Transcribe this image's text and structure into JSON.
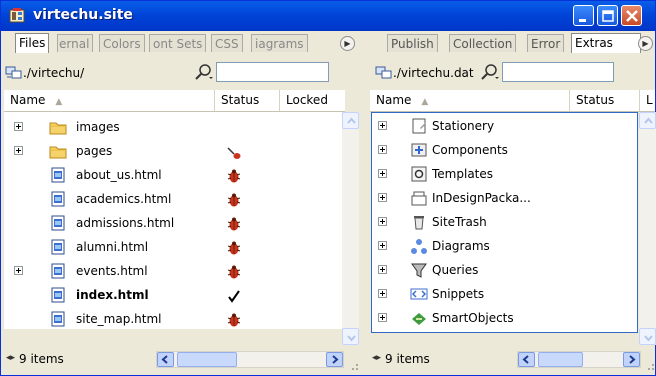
{
  "window": {
    "title": "virtechu.site",
    "controls": {
      "minimize": "minimize",
      "maximize": "maximize",
      "close": "close"
    }
  },
  "left_pane": {
    "tabs": [
      {
        "label": "Files",
        "active": true
      },
      {
        "label": "ernal",
        "active": false
      },
      {
        "label": "Colors",
        "active": false
      },
      {
        "label": "ont Sets",
        "active": false
      },
      {
        "label": "CSS",
        "active": false
      },
      {
        "label": "iagrams",
        "active": false
      }
    ],
    "path": "./virtechu/",
    "search_value": "",
    "columns": {
      "name": "Name",
      "status": "Status",
      "locked": "Locked"
    },
    "items": [
      {
        "name": "images",
        "type": "folder",
        "expandable": true,
        "status": ""
      },
      {
        "name": "pages",
        "type": "folder",
        "expandable": true,
        "status": "checkout"
      },
      {
        "name": "about_us.html",
        "type": "html",
        "expandable": false,
        "status": "bug"
      },
      {
        "name": "academics.html",
        "type": "html",
        "expandable": false,
        "status": "bug"
      },
      {
        "name": "admissions.html",
        "type": "html",
        "expandable": false,
        "status": "bug"
      },
      {
        "name": "alumni.html",
        "type": "html",
        "expandable": false,
        "status": "bug"
      },
      {
        "name": "events.html",
        "type": "html",
        "expandable": true,
        "status": "bug"
      },
      {
        "name": "index.html",
        "type": "html",
        "expandable": false,
        "status": "check",
        "bold": true
      },
      {
        "name": "site_map.html",
        "type": "html",
        "expandable": false,
        "status": "bug"
      }
    ],
    "item_count": "9 items"
  },
  "right_pane": {
    "tabs": [
      {
        "label": "Publish",
        "active": false
      },
      {
        "label": "Collection",
        "active": false
      },
      {
        "label": "Error",
        "active": false
      },
      {
        "label": "Extras",
        "active": true
      }
    ],
    "path": "./virtechu.dat",
    "search_value": "",
    "columns": {
      "name": "Name",
      "status": "Status",
      "locked": "L"
    },
    "items": [
      {
        "name": "Stationery",
        "icon": "stationery-icon"
      },
      {
        "name": "Components",
        "icon": "components-icon"
      },
      {
        "name": "Templates",
        "icon": "templates-icon"
      },
      {
        "name": "InDesignPacka...",
        "icon": "indesign-package-icon"
      },
      {
        "name": "SiteTrash",
        "icon": "trash-icon"
      },
      {
        "name": "Diagrams",
        "icon": "diagrams-icon"
      },
      {
        "name": "Queries",
        "icon": "queries-icon"
      },
      {
        "name": "Snippets",
        "icon": "snippets-icon"
      },
      {
        "name": "SmartObjects",
        "icon": "smartobjects-icon"
      }
    ],
    "item_count": "9 items"
  },
  "colors": {
    "title_blue": "#0A5EE8",
    "selection_border": "#316AC5",
    "bug_red": "#C8341C"
  }
}
